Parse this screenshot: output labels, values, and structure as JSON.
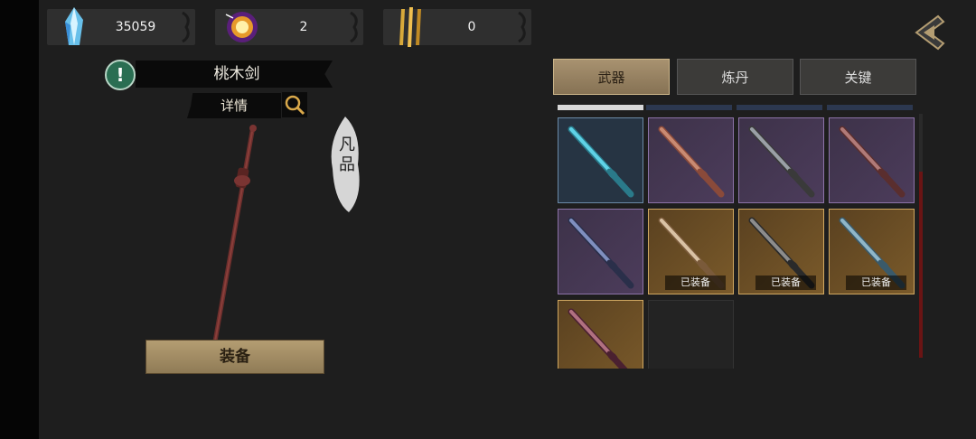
{
  "currencies": [
    {
      "name": "blue-crystal",
      "value": "35059"
    },
    {
      "name": "golden-orb",
      "value": "2"
    },
    {
      "name": "golden-blades",
      "value": "0"
    }
  ],
  "item": {
    "name": "桃木剑",
    "detail_label": "详情",
    "grade": "凡品",
    "equip_label": "装备"
  },
  "tabs": [
    {
      "label": "武器",
      "active": true
    },
    {
      "label": "炼丹",
      "active": false
    },
    {
      "label": "关键",
      "active": false
    }
  ],
  "grid": {
    "equipped_label": "已装备",
    "cells": [
      {
        "rarity": "blue",
        "equipped": false,
        "icon": "cyan-sword-icon"
      },
      {
        "rarity": "purple",
        "equipped": false,
        "icon": "copper-sword-icon"
      },
      {
        "rarity": "purple",
        "equipped": false,
        "icon": "steel-sword-icon"
      },
      {
        "rarity": "purple",
        "equipped": false,
        "icon": "bronze-sword-icon"
      },
      {
        "rarity": "purple",
        "equipped": false,
        "icon": "dark-sword-icon"
      },
      {
        "rarity": "gold",
        "equipped": true,
        "icon": "wooden-sword-icon"
      },
      {
        "rarity": "gold",
        "equipped": true,
        "icon": "iron-sword-icon"
      },
      {
        "rarity": "gold",
        "equipped": true,
        "icon": "jade-sword-icon"
      },
      {
        "rarity": "gold",
        "equipped": false,
        "icon": "twisted-sword-icon"
      },
      {
        "rarity": "empty",
        "equipped": false,
        "icon": ""
      }
    ]
  },
  "colors": {
    "accent_gold": "#d0a861",
    "tab_active": "#a89270",
    "alert_green": "#2a6e52",
    "scroll_thumb": "#6a1414"
  }
}
